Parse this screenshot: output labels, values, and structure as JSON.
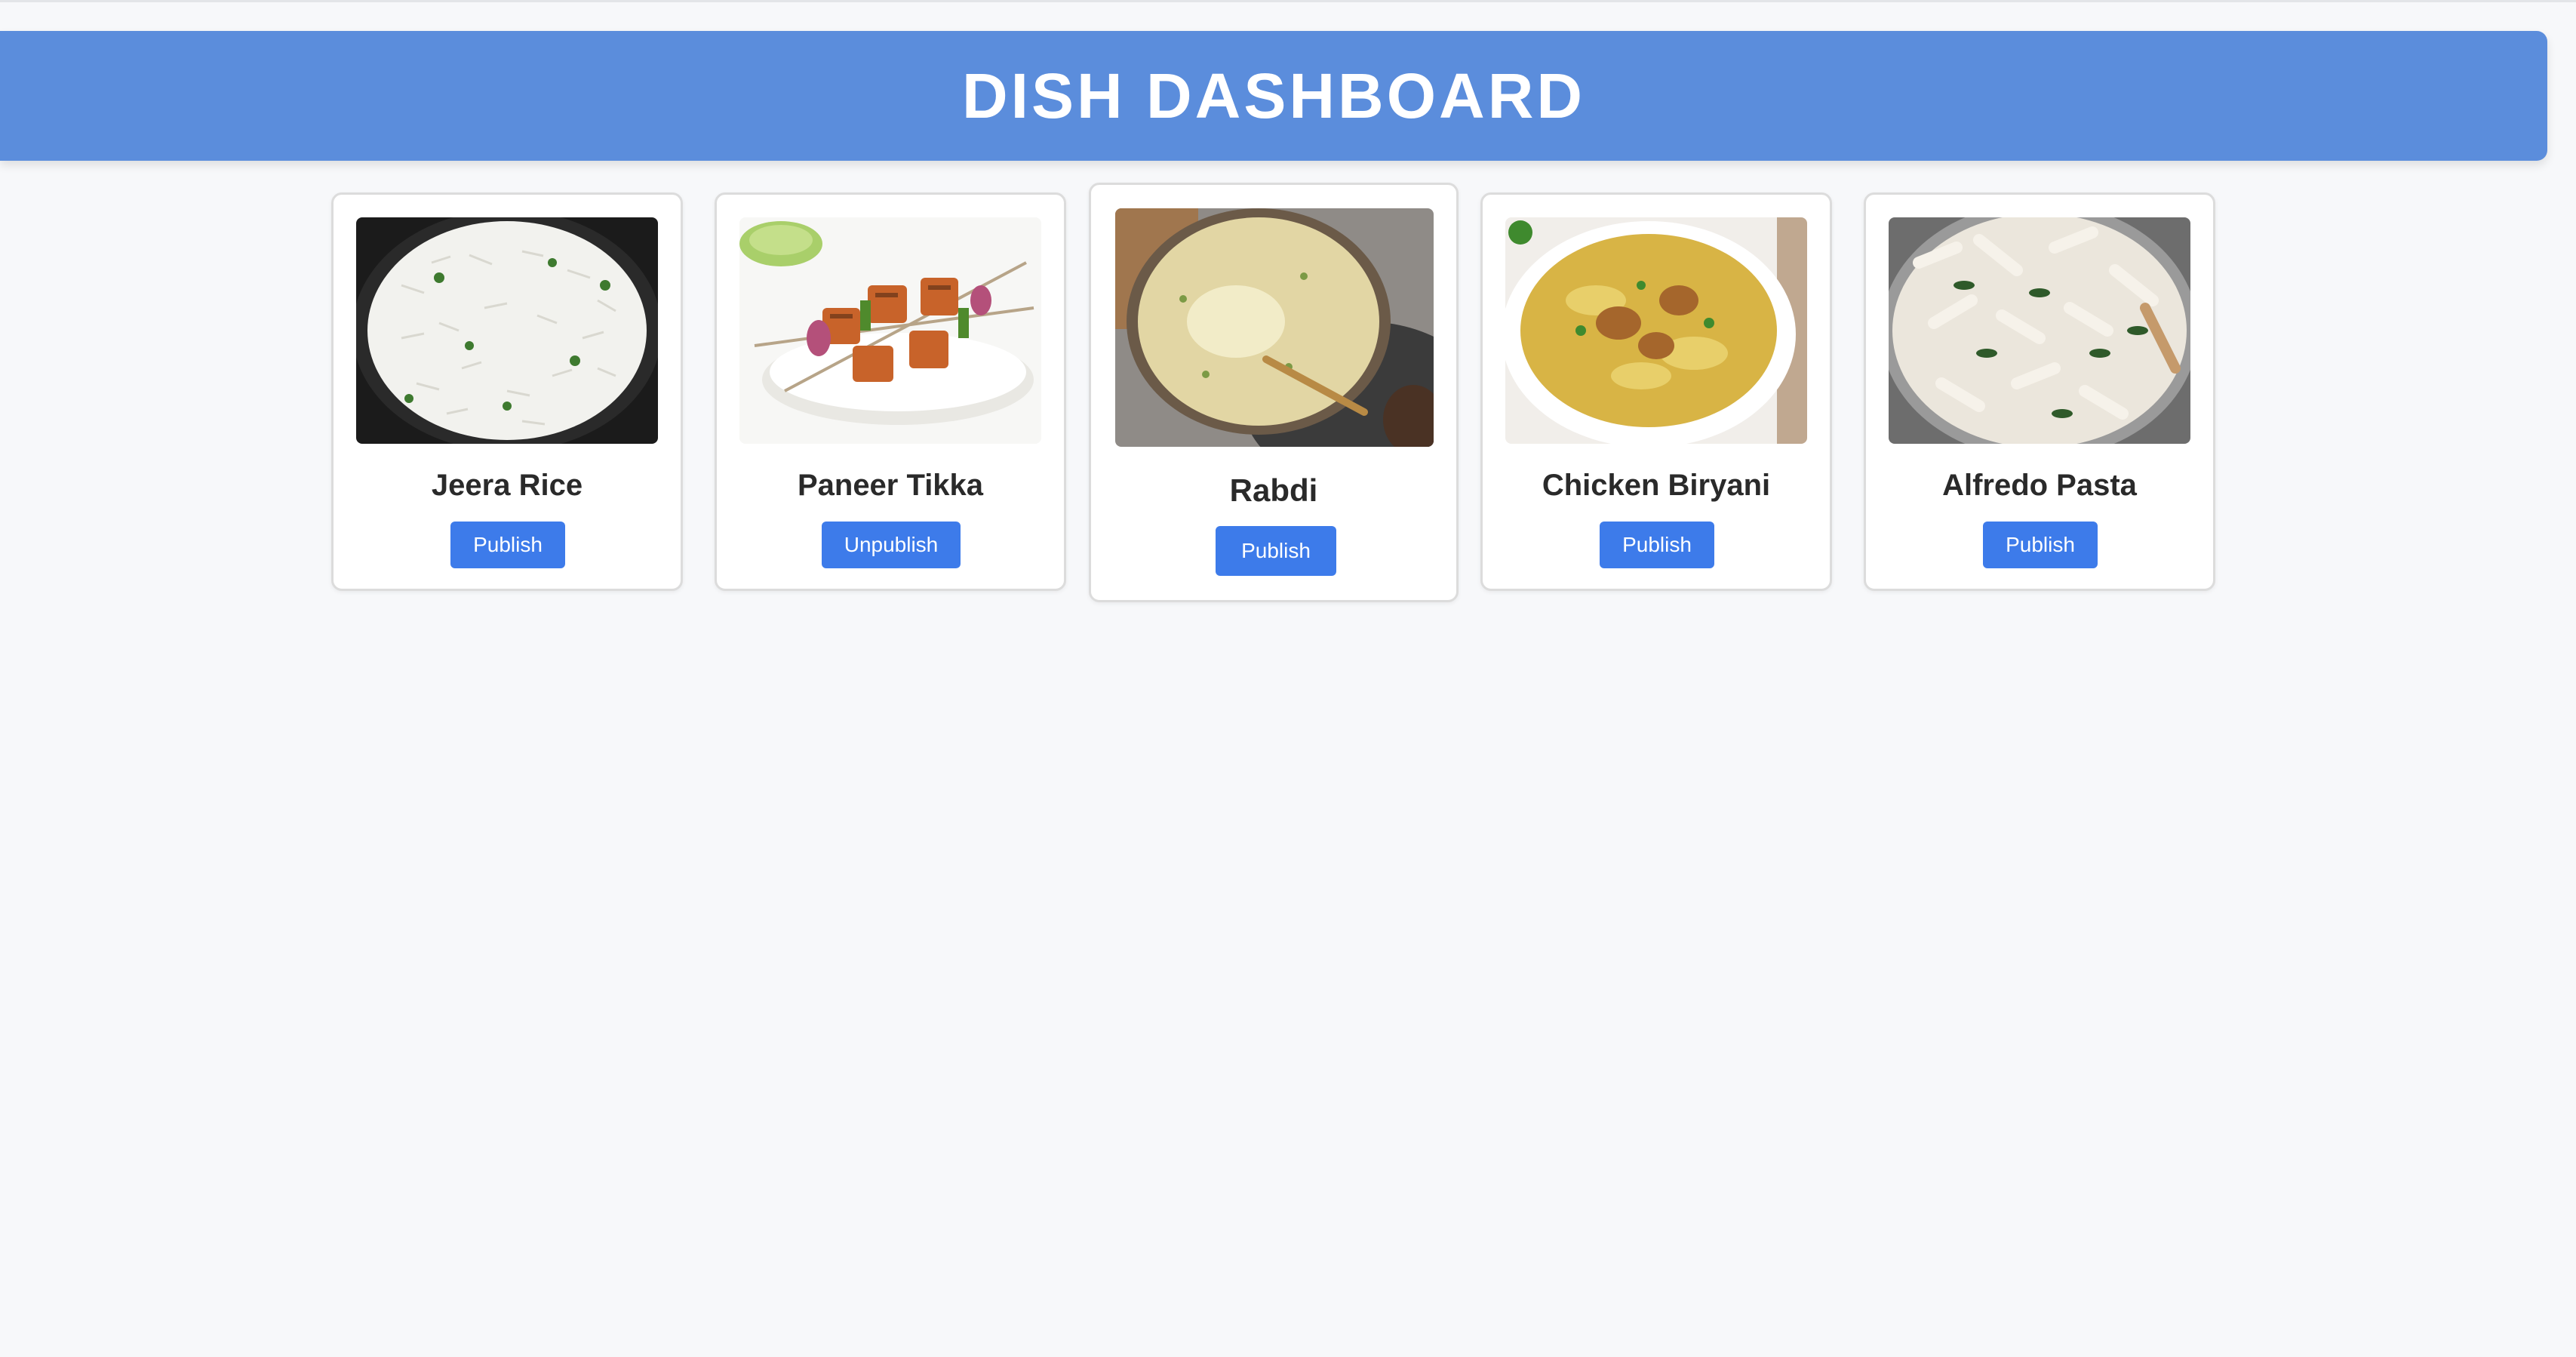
{
  "header": {
    "title": "DISH DASHBOARD"
  },
  "colors": {
    "header_bg": "#5b8ddc",
    "button_bg": "#3d7bea",
    "page_bg": "#f7f8fa"
  },
  "dishes": [
    {
      "name": "Jeera Rice",
      "action": "Publish",
      "image": "jeera-rice-photo"
    },
    {
      "name": "Paneer Tikka",
      "action": "Unpublish",
      "image": "paneer-tikka-photo"
    },
    {
      "name": "Rabdi",
      "action": "Publish",
      "image": "rabdi-photo"
    },
    {
      "name": "Chicken Biryani",
      "action": "Publish",
      "image": "chicken-biryani-photo"
    },
    {
      "name": "Alfredo Pasta",
      "action": "Publish",
      "image": "alfredo-pasta-photo"
    }
  ]
}
